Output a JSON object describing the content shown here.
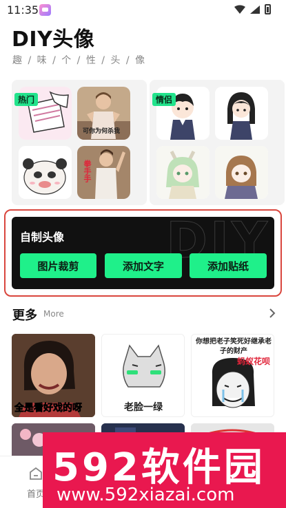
{
  "status": {
    "time": "11:35"
  },
  "header": {
    "title": "DIY头像",
    "subtitle": "趣 / 味 / 个 / 性 / 头 / 像"
  },
  "categories": [
    {
      "tag": "热门",
      "thumb_texts": [
        "",
        "可你为何杀我",
        "",
        "拳手手"
      ]
    },
    {
      "tag": "情侣",
      "thumb_texts": [
        "",
        "",
        "",
        ""
      ]
    }
  ],
  "diy": {
    "title": "自制头像",
    "watermark": "DIY",
    "buttons": [
      "图片裁剪",
      "添加文字",
      "添加贴纸"
    ]
  },
  "more": {
    "title": "更多",
    "subtitle": "More"
  },
  "grid": [
    {
      "caption": "全是看好戏的呀"
    },
    {
      "caption": "老脸一绿"
    },
    {
      "caption_top": "你想把老子笑死好继承老子的财产",
      "caption_red": "蚂蚁花呗"
    },
    {
      "caption": ""
    },
    {
      "caption": ""
    },
    {
      "caption": ""
    }
  ],
  "bottom_nav": {
    "home_label": "首页"
  },
  "watermark": {
    "logo": "592软件园",
    "url": "www.592xiazai.com"
  },
  "colors": {
    "accent": "#1ff08a",
    "panel": "#111111",
    "outline": "#d9453c",
    "banner": "#e9184f"
  }
}
